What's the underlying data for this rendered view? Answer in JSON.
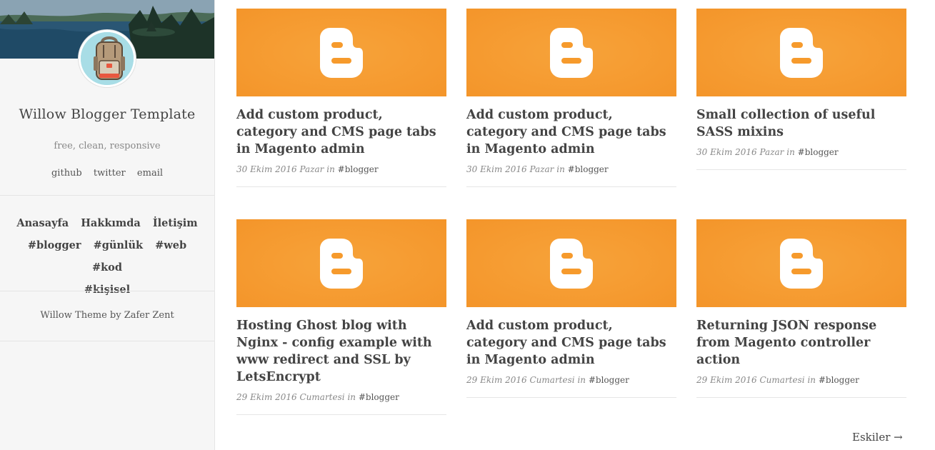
{
  "blog": {
    "title": "Willow Blogger Template",
    "tagline": "free, clean, responsive",
    "social": [
      "github",
      "twitter",
      "email"
    ]
  },
  "menu": {
    "pages": [
      "Anasayfa",
      "Hakkımda",
      "İletişim"
    ],
    "tags": [
      "#blogger",
      "#günlük",
      "#web",
      "#kod",
      "#kişisel"
    ]
  },
  "credit": "Willow Theme by Zafer Zent",
  "thumb_color": "#f69a2c",
  "icon": "blogger-logo-icon",
  "posts": [
    {
      "title": "Add custom product, category and CMS page tabs in Magento admin",
      "date": "30 Ekim 2016 Pazar",
      "in": "in",
      "tag": "#blogger"
    },
    {
      "title": "Add custom product, category and CMS page tabs in Magento admin",
      "date": "30 Ekim 2016 Pazar",
      "in": "in",
      "tag": "#blogger"
    },
    {
      "title": "Small collection of useful SASS mixins",
      "date": "30 Ekim 2016 Pazar",
      "in": "in",
      "tag": "#blogger"
    },
    {
      "title": "Hosting Ghost blog with Nginx - config example with www redirect and SSL by LetsEncrypt",
      "date": "29 Ekim 2016 Cumartesi",
      "in": "in",
      "tag": "#blogger"
    },
    {
      "title": "Add custom product, category and CMS page tabs in Magento admin",
      "date": "29 Ekim 2016 Cumartesi",
      "in": "in",
      "tag": "#blogger"
    },
    {
      "title": "Returning JSON response from Magento controller action",
      "date": "29 Ekim 2016 Cumartesi",
      "in": "in",
      "tag": "#blogger"
    }
  ],
  "pagination": {
    "older": "Eskiler →"
  }
}
